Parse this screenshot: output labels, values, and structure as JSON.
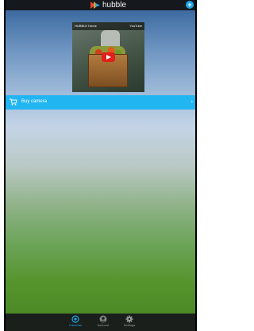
{
  "app": {
    "logo_text": "hubble",
    "add_icon": "plus-icon"
  },
  "video": {
    "title": "HUBBLE Home",
    "source": "YouTube",
    "play_icon": "play-icon"
  },
  "buy_bar": {
    "label": "Buy camera",
    "icon": "cart-icon",
    "chevron": "›"
  },
  "bottom_nav": {
    "items": [
      {
        "label": "Cameras",
        "icon": "camera-icon",
        "active": true
      },
      {
        "label": "Account",
        "icon": "account-icon",
        "active": false
      },
      {
        "label": "Settings",
        "icon": "gear-icon",
        "active": false
      }
    ]
  },
  "colors": {
    "accent": "#1ea4e6",
    "buy_bar": "#21b5f2",
    "topbar": "#15191d",
    "bottombar": "#1a1f1c"
  }
}
